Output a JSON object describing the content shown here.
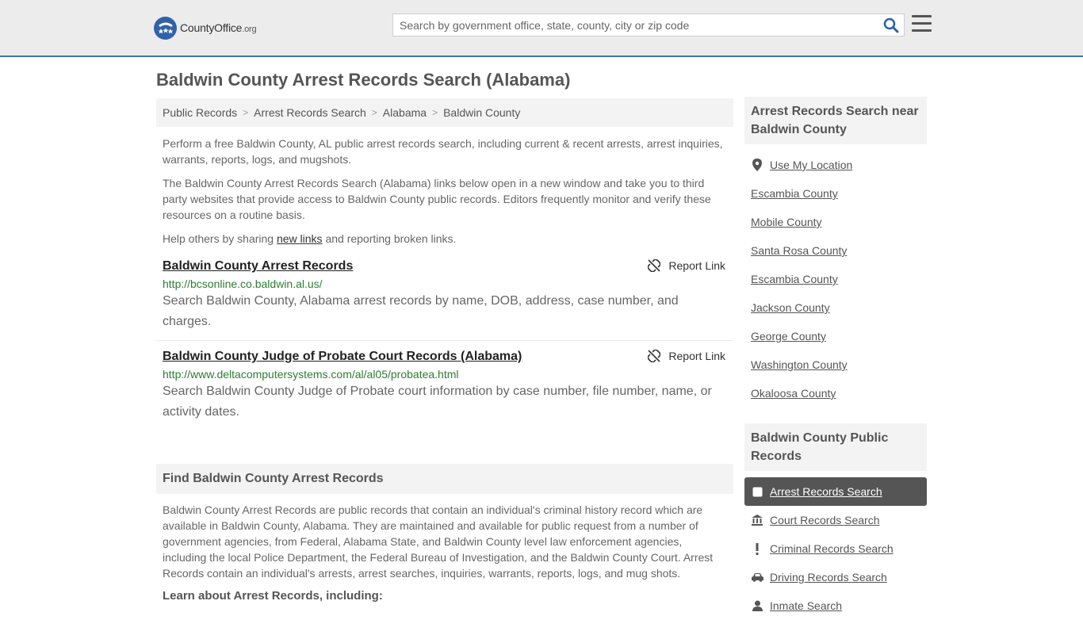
{
  "header": {
    "logo_name": "CountyOffice",
    "logo_tld": ".org",
    "search_placeholder": "Search by government office, state, county, city or zip code"
  },
  "page": {
    "title": "Baldwin County Arrest Records Search (Alabama)"
  },
  "breadcrumb": [
    "Public Records",
    "Arrest Records Search",
    "Alabama",
    "Baldwin County"
  ],
  "intro": {
    "p1": "Perform a free Baldwin County, AL public arrest records search, including current & recent arrests, arrest inquiries, warrants, reports, logs, and mugshots.",
    "p2": "The Baldwin County Arrest Records Search (Alabama) links below open in a new window and take you to third party websites that provide access to Baldwin County public records. Editors frequently monitor and verify these resources on a routine basis.",
    "p3_before": "Help others by sharing ",
    "p3_link": "new links",
    "p3_after": " and reporting broken links."
  },
  "records": [
    {
      "title": "Baldwin County Arrest Records",
      "url": "http://bcsonline.co.baldwin.al.us/",
      "desc": "Search Baldwin County, Alabama arrest records by name, DOB, address, case number, and charges.",
      "report_label": "Report Link"
    },
    {
      "title": "Baldwin County Judge of Probate Court Records (Alabama)",
      "url": "http://www.deltacomputersystems.com/al/al05/probatea.html",
      "desc": "Search Baldwin County Judge of Probate court information by case number, file number, name, or activity dates.",
      "report_label": "Report Link"
    }
  ],
  "find_section": {
    "heading": "Find Baldwin County Arrest Records",
    "body": "Baldwin County Arrest Records are public records that contain an individual's criminal history record which are available in Baldwin County, Alabama. They are maintained and available for public request from a number of government agencies, from Federal, Alabama State, and Baldwin County level law enforcement agencies, including the local Police Department, the Federal Bureau of Investigation, and the Baldwin County Court. Arrest Records contain an individual's arrests, arrest searches, inquiries, warrants, reports, logs, and mug shots.",
    "learn": "Learn about Arrest Records, including:"
  },
  "sidebar": {
    "near_heading": "Arrest Records Search near Baldwin County",
    "use_location": "Use My Location",
    "nearby": [
      "Escambia County",
      "Mobile County",
      "Santa Rosa County",
      "Escambia County",
      "Jackson County",
      "George County",
      "Washington County",
      "Okaloosa County"
    ],
    "public_heading": "Baldwin County Public Records",
    "public_items": [
      {
        "label": "Arrest Records Search",
        "icon": "checkbox-icon"
      },
      {
        "label": "Court Records Search",
        "icon": "courthouse-icon"
      },
      {
        "label": "Criminal Records Search",
        "icon": "exclamation-icon"
      },
      {
        "label": "Driving Records Search",
        "icon": "car-icon"
      },
      {
        "label": "Inmate Search",
        "icon": "inmate-icon"
      }
    ]
  },
  "colors": {
    "accent_border": "#3a78b8",
    "url_green": "#2e7d32",
    "active_item_bg": "#555555"
  }
}
